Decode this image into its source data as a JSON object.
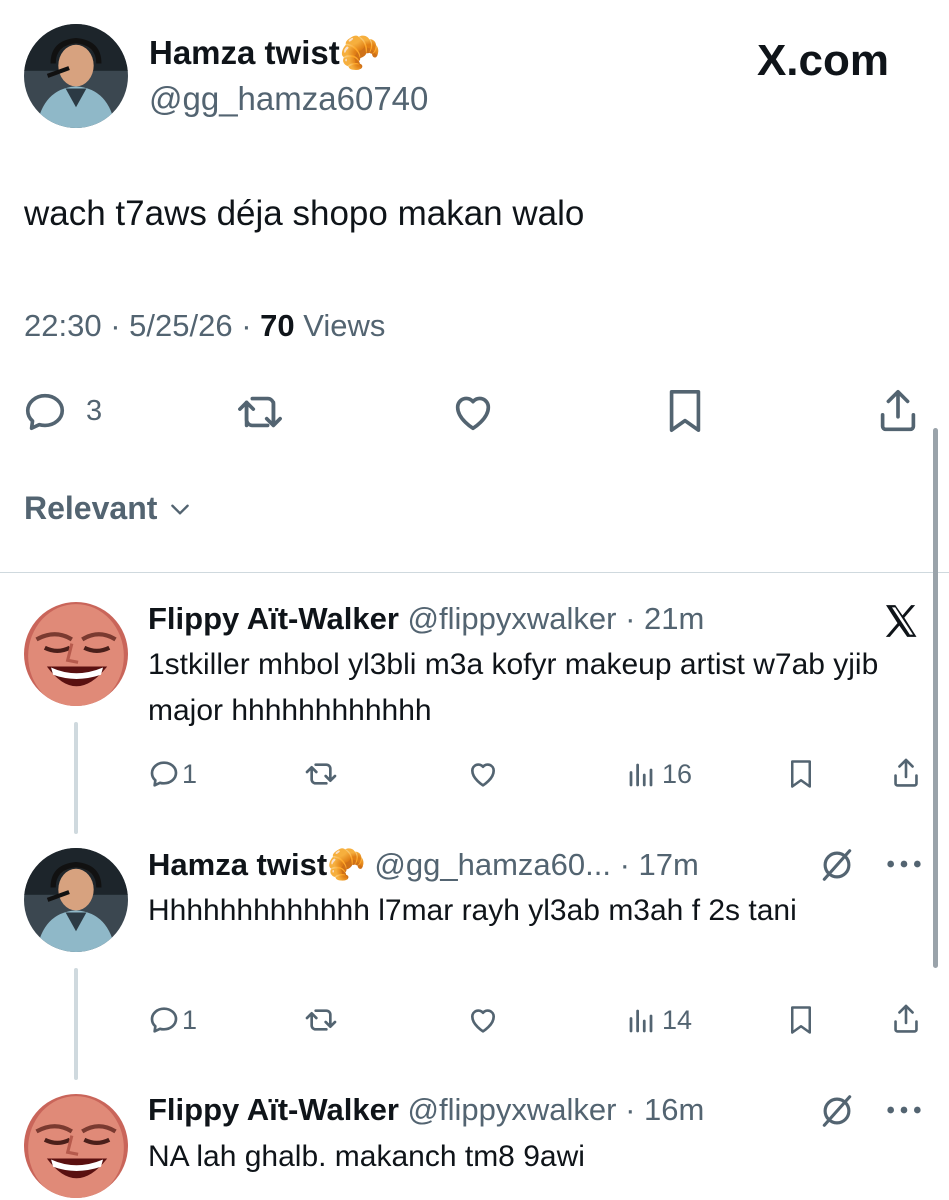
{
  "brand": "X.com",
  "main_tweet": {
    "author_name": "Hamza twist",
    "author_emoji": "🥐",
    "author_handle": "@gg_hamza60740",
    "text": "wach t7aws déja shopo makan walo",
    "time": "22:30",
    "date": "5/25/26",
    "views_count": "70",
    "views_label": "Views",
    "replies_count": "3"
  },
  "sort": {
    "label": "Relevant"
  },
  "replies": [
    {
      "author_name": "Flippy Aït-Walker",
      "author_handle": "@flippyxwalker",
      "time": "· 21m",
      "text": "1stkiller mhbol yl3bli m3a kofyr makeup artist w7ab yjib major hhhhhhhhhhhh",
      "reply_count": "1",
      "views": "16",
      "corner_icon": "x-logo-icon"
    },
    {
      "author_name": "Hamza twist",
      "author_emoji": "🥐",
      "author_handle": "@gg_hamza60...",
      "time": "· 17m",
      "text": "Hhhhhhhhhhhhh l7mar rayh yl3ab m3ah f 2s tani",
      "reply_count": "1",
      "views": "14",
      "corner_icon": "grok-icon"
    },
    {
      "author_name": "Flippy Aït-Walker",
      "author_handle": "@flippyxwalker",
      "time": "· 16m",
      "text": "NA lah ghalb. makanch tm8 9awi",
      "corner_icon": "grok-icon"
    }
  ],
  "colors": {
    "text": "#0f1419",
    "secondary": "#536471",
    "divider": "#cfd9de"
  }
}
